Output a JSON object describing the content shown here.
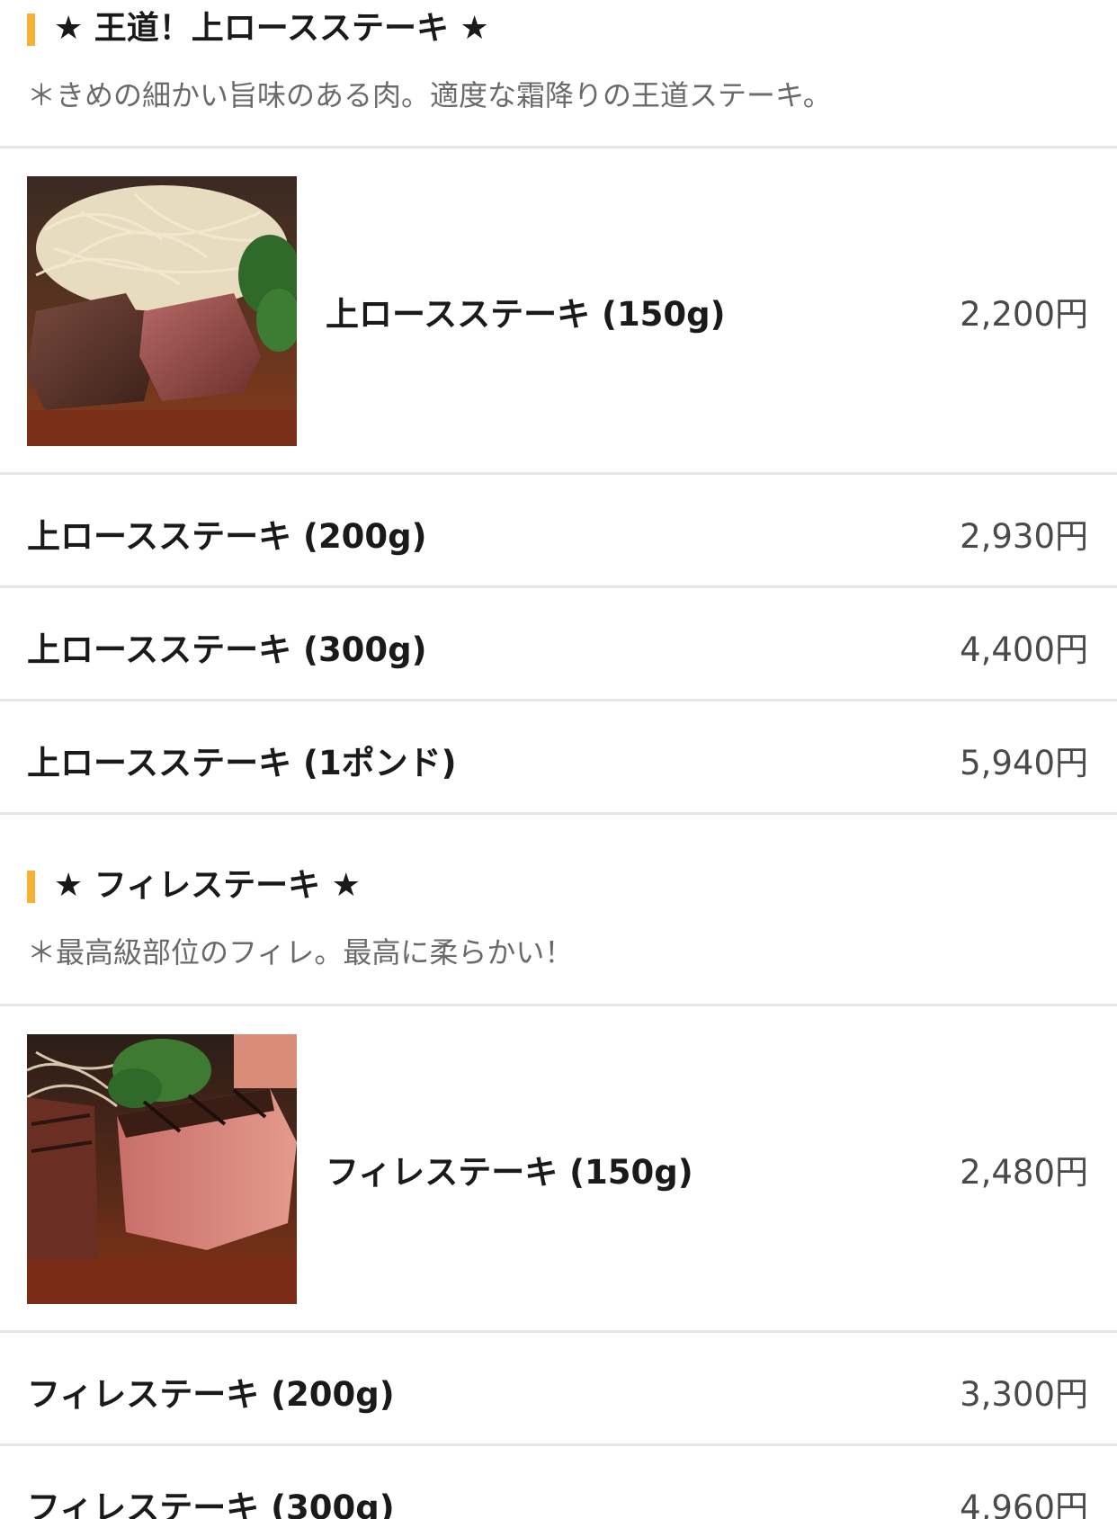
{
  "sections": [
    {
      "title": "★ 王道！上ロースステーキ ★",
      "note": "＊きめの細かい旨味のある肉。適度な霜降りの王道ステーキ。",
      "featured": {
        "photo_icon": "steak-photo",
        "name": "上ロースステーキ (150g)",
        "price": "2,200円"
      },
      "items": [
        {
          "name": "上ロースステーキ (200g)",
          "price": "2,930円"
        },
        {
          "name": "上ロースステーキ (300g)",
          "price": "4,400円"
        },
        {
          "name": "上ロースステーキ (1ポンド)",
          "price": "5,940円"
        }
      ]
    },
    {
      "title": "★ フィレステーキ ★",
      "note": "＊最高級部位のフィレ。最高に柔らかい！",
      "featured": {
        "photo_icon": "fillet-steak-photo",
        "name": "フィレステーキ (150g)",
        "price": "2,480円"
      },
      "items": [
        {
          "name": "フィレステーキ (200g)",
          "price": "3,300円"
        },
        {
          "name": "フィレステーキ (300g)",
          "price": "4,960円"
        }
      ]
    }
  ],
  "colors": {
    "accent_bar": "#f5b035",
    "divider": "#e6e6e6",
    "note_text": "#6a6a6a",
    "price_text": "#4a4a4a"
  }
}
